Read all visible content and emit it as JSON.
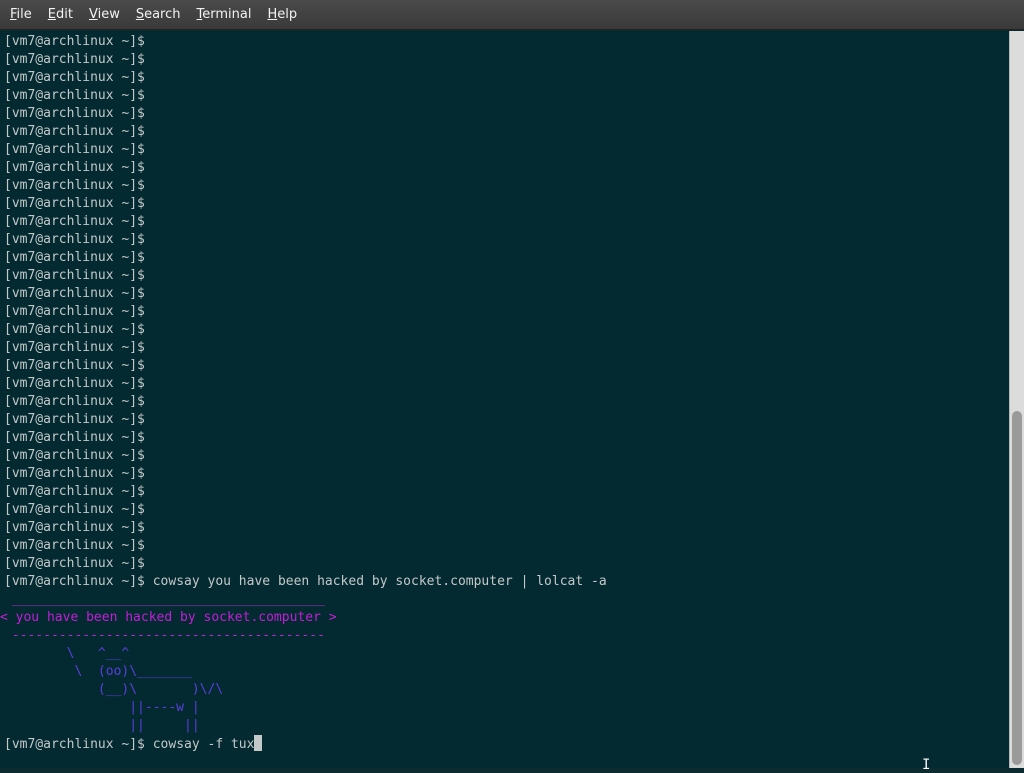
{
  "menubar": {
    "items": [
      {
        "mnemonic": "F",
        "rest": "ile"
      },
      {
        "mnemonic": "E",
        "rest": "dit"
      },
      {
        "mnemonic": "V",
        "rest": "iew"
      },
      {
        "mnemonic": "S",
        "rest": "earch"
      },
      {
        "mnemonic": "T",
        "rest": "erminal"
      },
      {
        "mnemonic": "H",
        "rest": "elp"
      }
    ]
  },
  "terminal": {
    "prompt": "[vm7@archlinux ~]$",
    "empty_prompt_count": 30,
    "command1": " cowsay you have been hacked by socket.computer | lolcat -a",
    "cowsay_output": {
      "top_border": " ________________________________________",
      "message": "< you have been hacked by socket.computer >",
      "bottom_border": " ----------------------------------------",
      "cow_lines": [
        "        \\   ^__^",
        "         \\  (oo)\\_______",
        "            (__)\\       )\\/\\",
        "                ||----w |",
        "                ||     ||"
      ]
    },
    "current_command": " cowsay -f tux",
    "colors": {
      "background": "#032a31",
      "foreground": "#c3c8c9",
      "message": "#c21fd6",
      "border": "#b52bd0",
      "cow": "#5a3fdc"
    }
  }
}
